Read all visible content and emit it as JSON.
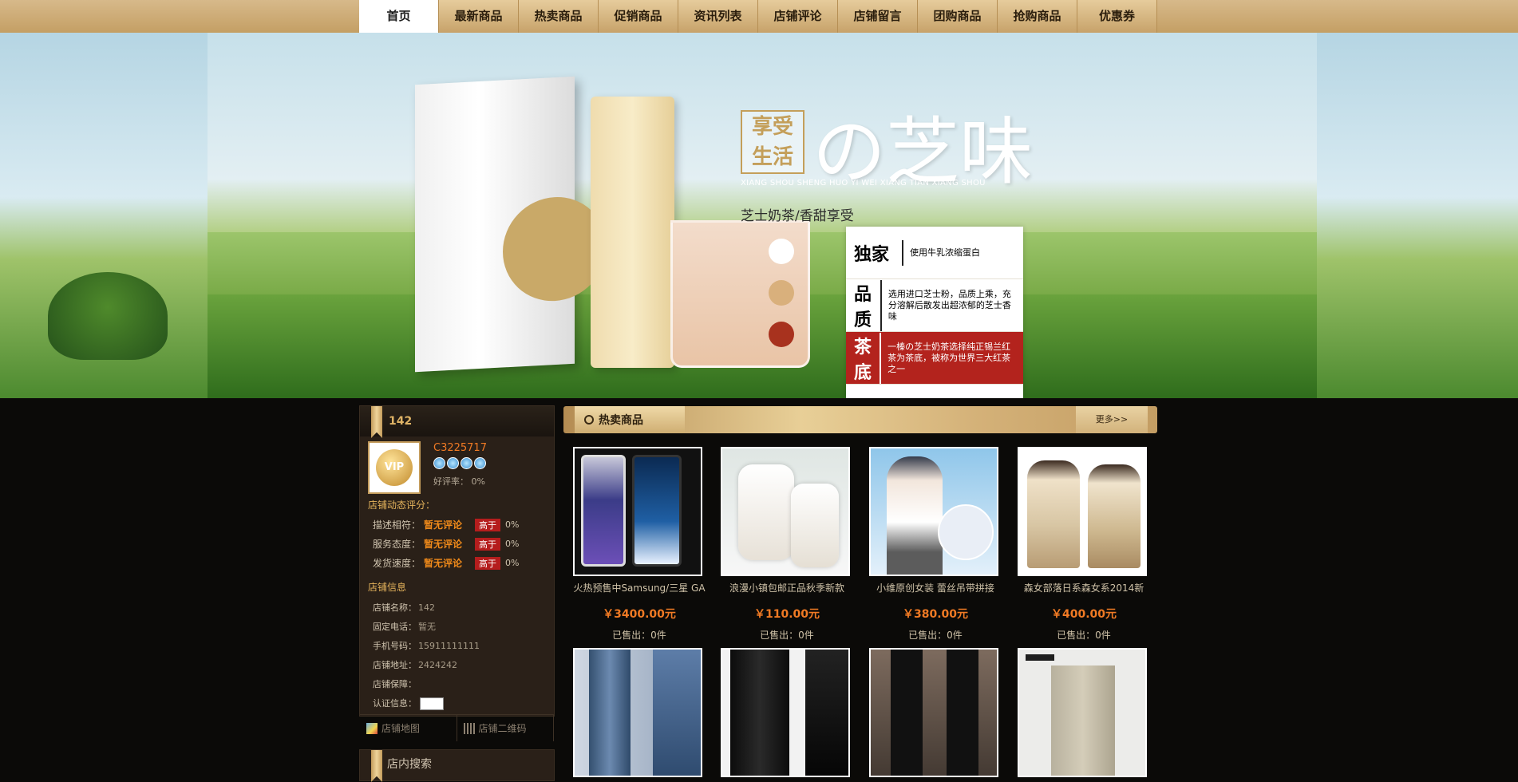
{
  "nav": {
    "items": [
      "首页",
      "最新商品",
      "热卖商品",
      "促销商品",
      "资讯列表",
      "店铺评论",
      "店铺留言",
      "团购商品",
      "抢购商品",
      "优惠券"
    ],
    "active": "首页"
  },
  "banner": {
    "seal_text": "享受生活",
    "title": "の芝味",
    "pinyin": "XIANG SHOU SHENG HUO YI WEI XIANG TIAN XIANG SHOU",
    "subtitle": "芝士奶茶/香甜享受",
    "features": [
      {
        "key": "独家",
        "desc": "使用牛乳浓缩蛋白"
      },
      {
        "key": "品质",
        "desc": "选用进口芝士粉，品质上乘，充分溶解后散发出超浓郁的芝士香味"
      },
      {
        "key": "茶底",
        "desc": "一榛の芝士奶茶选择纯正锡兰红茶为茶底，被称为世界三大红茶之一"
      }
    ]
  },
  "shop": {
    "name": "142",
    "user_id": "C3225717",
    "vip_label": "VIP",
    "good_rate_label": "好评率：",
    "good_rate": "0%",
    "dynamic_title": "店铺动态评分：",
    "ratings": [
      {
        "label": "描述相符：",
        "value": "暂无评论",
        "compare": "高于",
        "pct": "0%"
      },
      {
        "label": "服务态度：",
        "value": "暂无评论",
        "compare": "高于",
        "pct": "0%"
      },
      {
        "label": "发货速度：",
        "value": "暂无评论",
        "compare": "高于",
        "pct": "0%"
      }
    ],
    "info_title": "店铺信息",
    "info": [
      {
        "label": "店铺名称：",
        "value": "142"
      },
      {
        "label": "固定电话：",
        "value": "暂无"
      },
      {
        "label": "手机号码：",
        "value": "15911111111"
      },
      {
        "label": "店铺地址：",
        "value": "2424242"
      },
      {
        "label": "店铺保障：",
        "value": ""
      },
      {
        "label": "认证信息：",
        "value": ""
      }
    ],
    "tabs": [
      "店铺地图",
      "店铺二维码"
    ],
    "search_title": "店内搜索"
  },
  "hot": {
    "title": "热卖商品",
    "more": "更多>>",
    "products": [
      {
        "name": "火热预售中Samsung/三星 GA",
        "price": "￥3400.00元",
        "sold": "已售出：0件"
      },
      {
        "name": "浪漫小镇包邮正品秋季新款",
        "price": "￥110.00元",
        "sold": "已售出：0件"
      },
      {
        "name": "小维原创女装 蕾丝吊带拼接",
        "price": "￥380.00元",
        "sold": "已售出：0件"
      },
      {
        "name": "森女部落日系森女系2014新",
        "price": "￥400.00元",
        "sold": "已售出：0件"
      }
    ]
  },
  "colors": {
    "accent_gold": "#c49f64",
    "price_orange": "#f07a24",
    "badge_red": "#b51d1d",
    "background": "#0b0a08"
  }
}
